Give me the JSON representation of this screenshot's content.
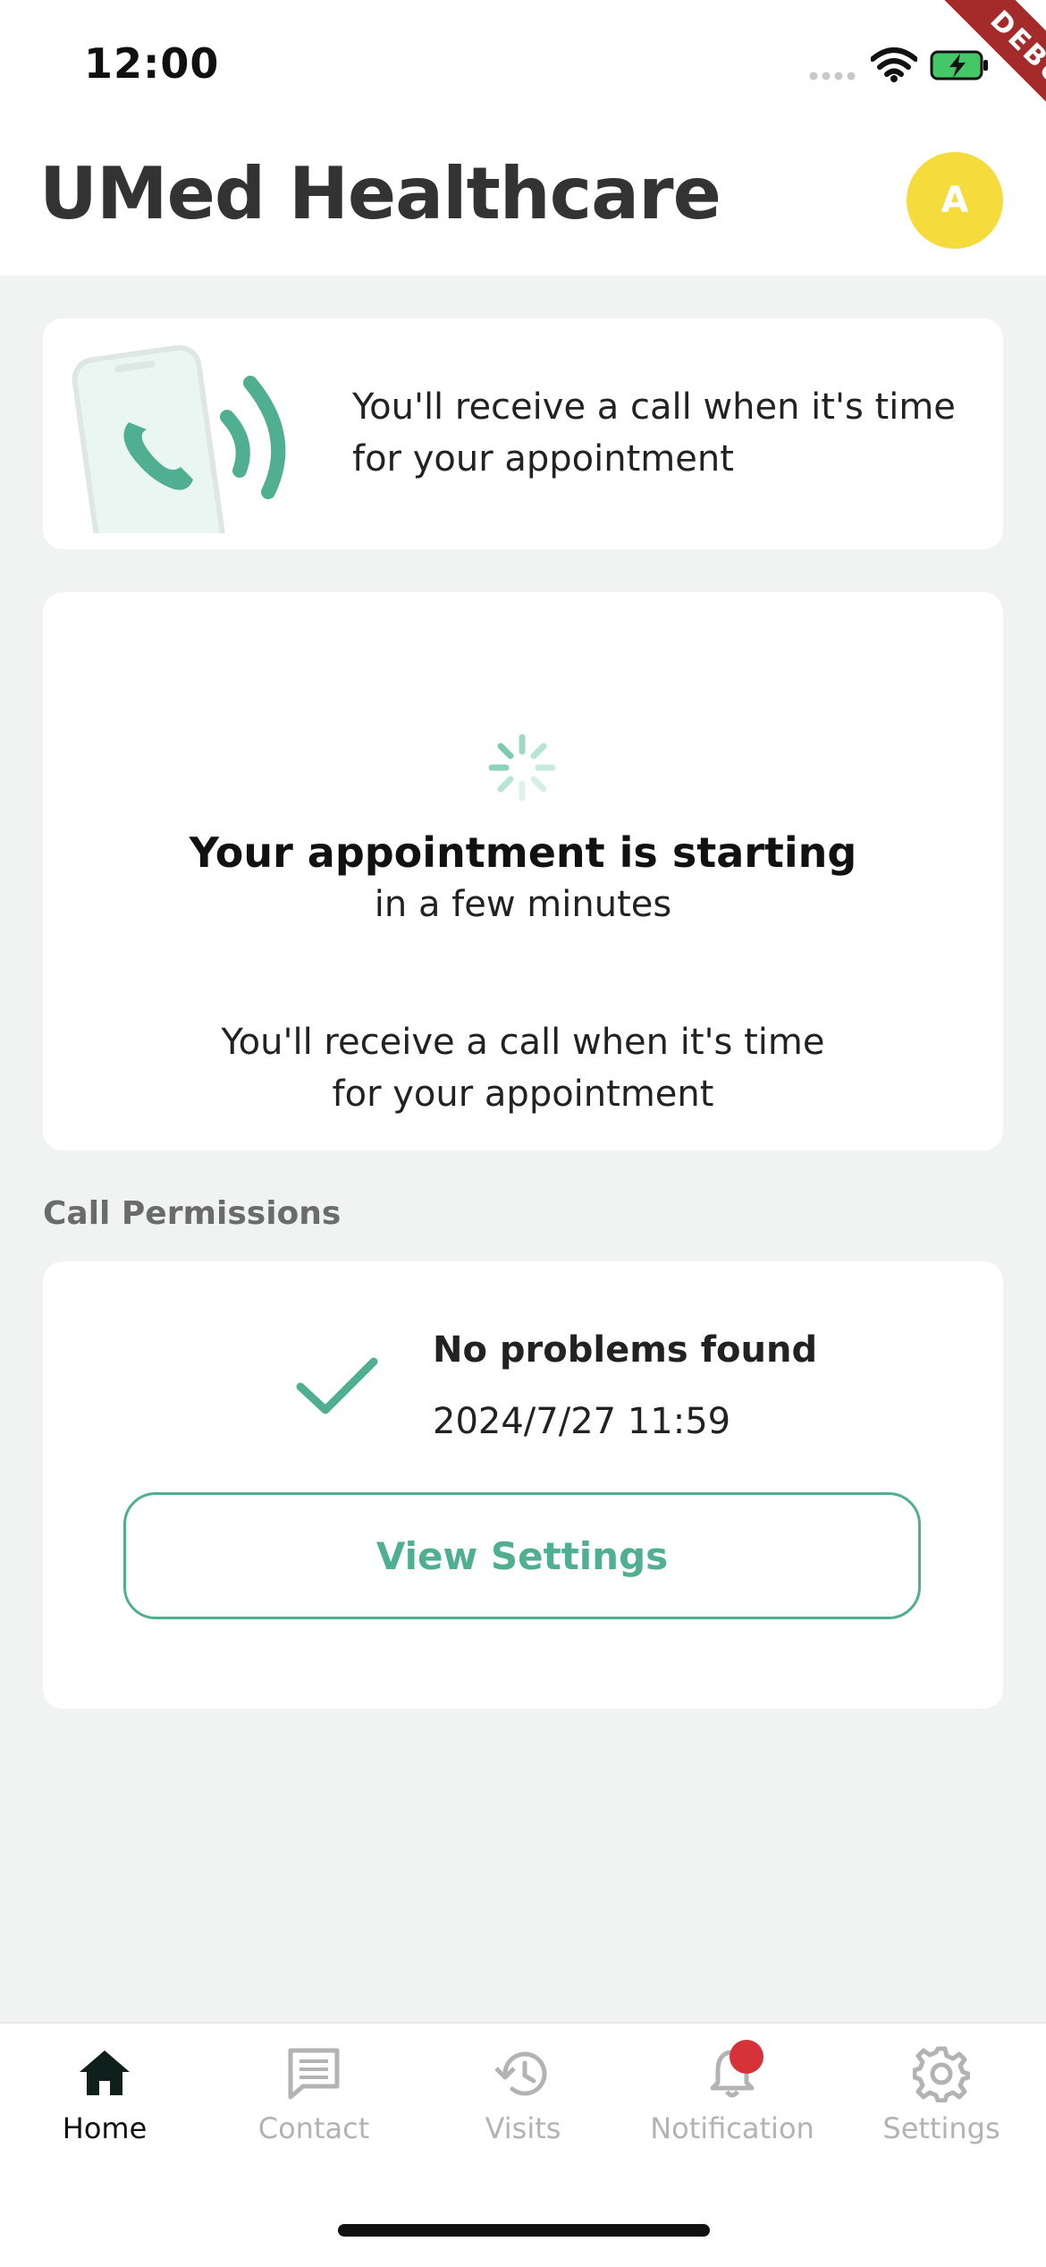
{
  "status_bar": {
    "time": "12:00",
    "icons": [
      "signal-dots-icon",
      "wifi-icon",
      "battery-charging-icon"
    ]
  },
  "debug_ribbon": "DEBUG",
  "header": {
    "title": "UMed Healthcare",
    "avatar_initial": "A"
  },
  "call_notice": {
    "icon": "phone-ringing-illustration",
    "text": "You'll receive a call when it's time for your appointment"
  },
  "appointment": {
    "icon": "loading-spinner-icon",
    "title": "Your appointment is starting",
    "subtitle": "in a few minutes",
    "note": "You'll receive a call when it's time for your appointment"
  },
  "permissions": {
    "section_label": "Call Permissions",
    "icon": "checkmark-icon",
    "status": "No problems found",
    "checked_at": "2024/7/27 11:59",
    "button_label": "View Settings"
  },
  "bottom_nav": {
    "items": [
      {
        "label": "Home",
        "icon": "home-icon",
        "active": true
      },
      {
        "label": "Contact",
        "icon": "chat-icon",
        "active": false
      },
      {
        "label": "Visits",
        "icon": "history-icon",
        "active": false
      },
      {
        "label": "Notification",
        "icon": "bell-icon",
        "active": false,
        "badge": true
      },
      {
        "label": "Settings",
        "icon": "gear-icon",
        "active": false
      }
    ]
  },
  "colors": {
    "accent": "#4faf90",
    "avatar": "#f5dc3c",
    "badge": "#d6323a",
    "background": "#f1f2f2"
  }
}
